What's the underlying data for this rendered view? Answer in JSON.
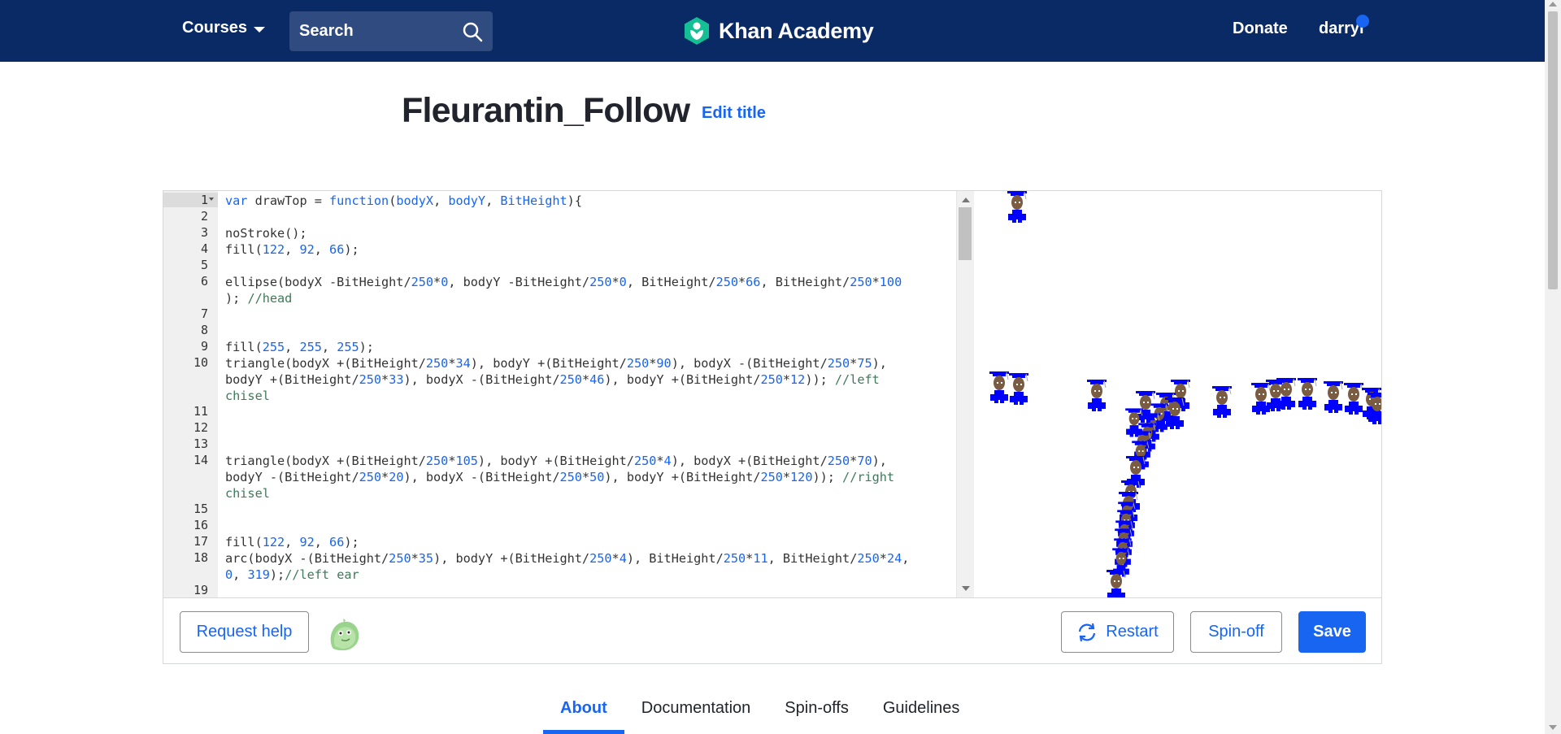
{
  "nav": {
    "courses_label": "Courses",
    "search_placeholder": "Search",
    "logo_text": "Khan Academy",
    "donate_label": "Donate",
    "user_label": "darryl",
    "brand_color": "#0a2a66",
    "logo_color": "#14bf96"
  },
  "page": {
    "title": "Fleurantin_Follow",
    "edit_title_label": "Edit title"
  },
  "editor": {
    "lines": [
      {
        "n": "1",
        "html": "<span class=\"kw\">var</span> drawTop = <span class=\"kw\">function</span>(<span class=\"kw\">bodyX</span>, <span class=\"kw\">bodyY</span>, <span class=\"kw\">BitHeight</span>){"
      },
      {
        "n": "2",
        "html": ""
      },
      {
        "n": "3",
        "html": "noStroke();"
      },
      {
        "n": "4",
        "html": "fill(<span class=\"num\">122</span>, <span class=\"num\">92</span>, <span class=\"num\">66</span>);"
      },
      {
        "n": "5",
        "html": ""
      },
      {
        "n": "6",
        "html": "ellipse(bodyX -BitHeight/<span class=\"num\">250</span>*<span class=\"num\">0</span>, bodyY -BitHeight/<span class=\"num\">250</span>*<span class=\"num\">0</span>, BitHeight/<span class=\"num\">250</span>*<span class=\"num\">66</span>, BitHeight/<span class=\"num\">250</span>*<span class=\"num\">100</span>\n); <span class=\"cm\">//head</span>"
      },
      {
        "n": "7",
        "html": ""
      },
      {
        "n": "8",
        "html": ""
      },
      {
        "n": "9",
        "html": "fill(<span class=\"num\">255</span>, <span class=\"num\">255</span>, <span class=\"num\">255</span>);"
      },
      {
        "n": "10",
        "html": "triangle(bodyX +(BitHeight/<span class=\"num\">250</span>*<span class=\"num\">34</span>), bodyY +(BitHeight/<span class=\"num\">250</span>*<span class=\"num\">90</span>), bodyX -(BitHeight/<span class=\"num\">250</span>*<span class=\"num\">75</span>),\nbodyY +(BitHeight/<span class=\"num\">250</span>*<span class=\"num\">33</span>), bodyX -(BitHeight/<span class=\"num\">250</span>*<span class=\"num\">46</span>), bodyY +(BitHeight/<span class=\"num\">250</span>*<span class=\"num\">12</span>)); <span class=\"cm\">//left\nchisel</span>"
      },
      {
        "n": "11",
        "html": ""
      },
      {
        "n": "12",
        "html": ""
      },
      {
        "n": "13",
        "html": ""
      },
      {
        "n": "14",
        "html": "triangle(bodyX +(BitHeight/<span class=\"num\">250</span>*<span class=\"num\">105</span>), bodyY +(BitHeight/<span class=\"num\">250</span>*<span class=\"num\">4</span>), bodyX +(BitHeight/<span class=\"num\">250</span>*<span class=\"num\">70</span>),\nbodyY -(BitHeight/<span class=\"num\">250</span>*<span class=\"num\">20</span>), bodyX -(BitHeight/<span class=\"num\">250</span>*<span class=\"num\">50</span>), bodyY +(BitHeight/<span class=\"num\">250</span>*<span class=\"num\">120</span>)); <span class=\"cm\">//right\nchisel</span>"
      },
      {
        "n": "15",
        "html": ""
      },
      {
        "n": "16",
        "html": ""
      },
      {
        "n": "17",
        "html": "fill(<span class=\"num\">122</span>, <span class=\"num\">92</span>, <span class=\"num\">66</span>);"
      },
      {
        "n": "18",
        "html": "arc(bodyX -(BitHeight/<span class=\"num\">250</span>*<span class=\"num\">35</span>), bodyY +(BitHeight/<span class=\"num\">250</span>*<span class=\"num\">4</span>), BitHeight/<span class=\"num\">250</span>*<span class=\"num\">11</span>, BitHeight/<span class=\"num\">250</span>*<span class=\"num\">24</span>,\n<span class=\"num\">0</span>, <span class=\"num\">319</span>);<span class=\"cm\">//left ear</span>"
      },
      {
        "n": "19",
        "html": ""
      }
    ]
  },
  "actions": {
    "request_help_label": "Request help",
    "restart_label": "Restart",
    "spinoff_label": "Spin-off",
    "save_label": "Save"
  },
  "tabs": [
    {
      "label": "About",
      "active": true
    },
    {
      "label": "Documentation",
      "active": false
    },
    {
      "label": "Spin-offs",
      "active": false
    },
    {
      "label": "Guidelines",
      "active": false
    }
  ],
  "colors": {
    "accent": "#1865f2",
    "figure_skin": "#7a5c42",
    "figure_body": "#0000ff"
  }
}
